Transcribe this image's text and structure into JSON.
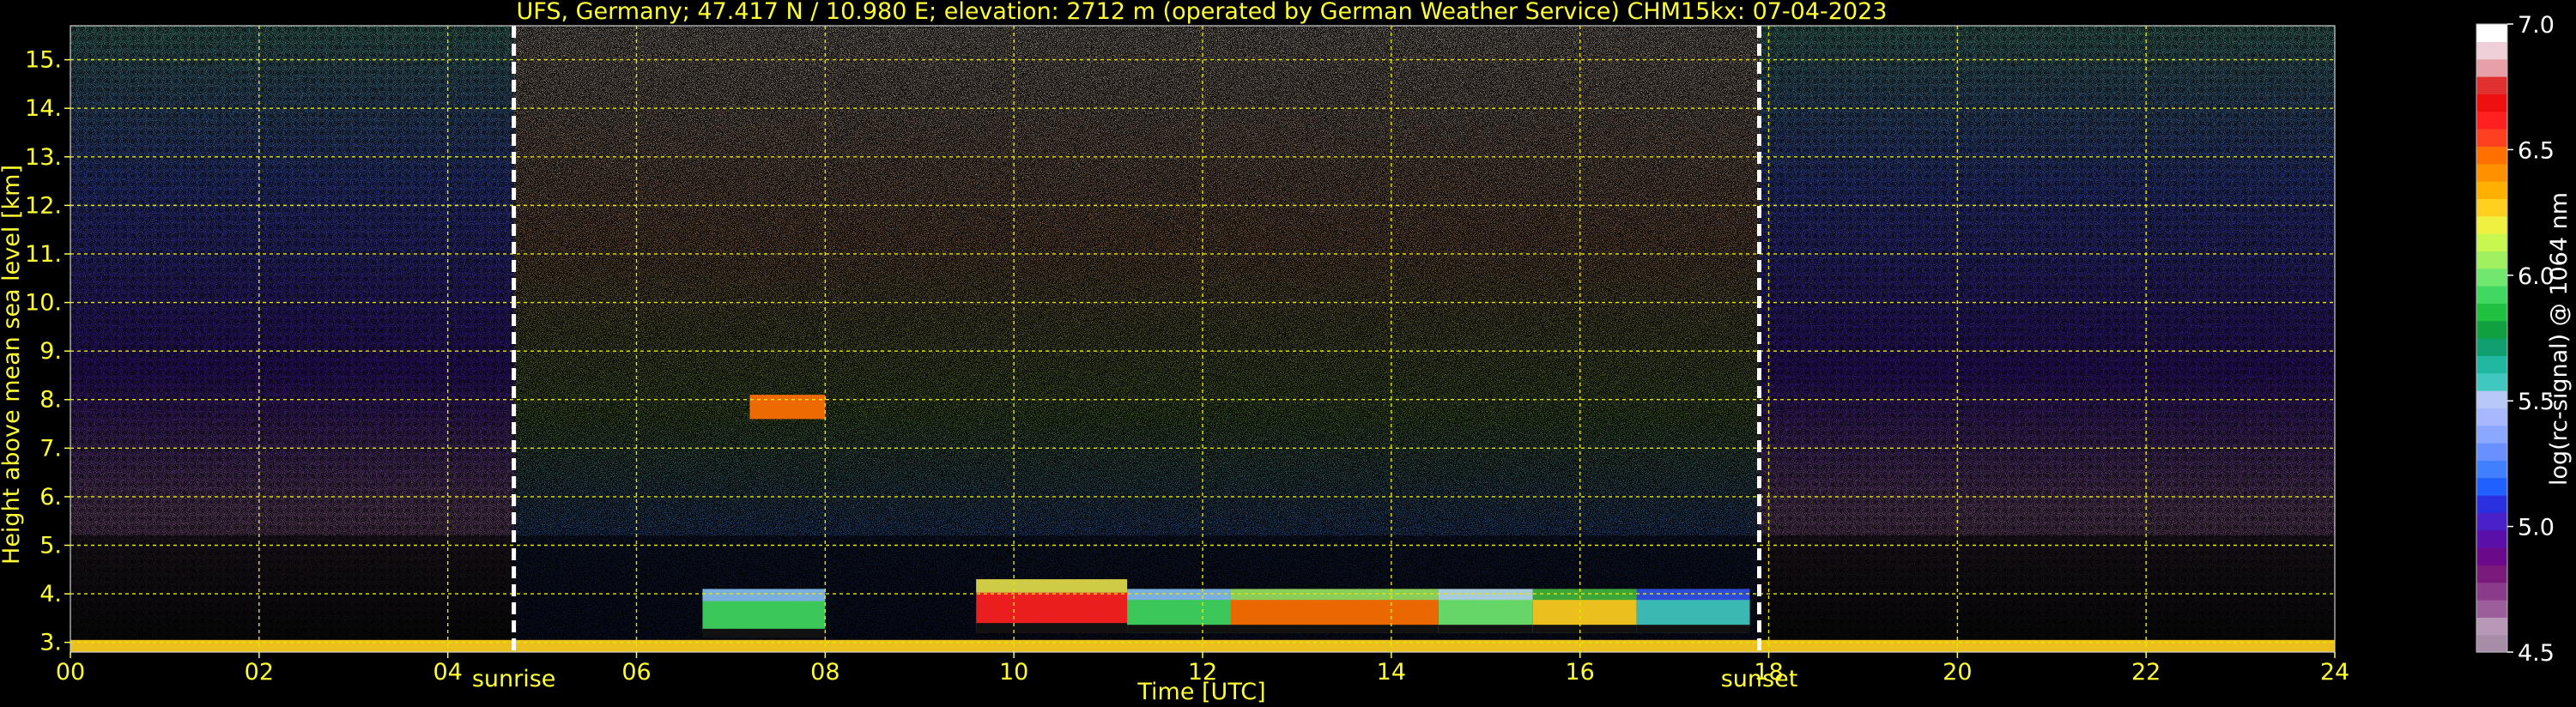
{
  "chart_data": {
    "type": "heatmap",
    "title": "UFS, Germany; 47.417 N / 10.980 E; elevation: 2712 m  (operated by German Weather Service)    CHM15kx: 07-04-2023",
    "xlabel": "Time [UTC]",
    "ylabel": "Height above mean sea level [km]",
    "colorbar_label": "log(rc-signal) @ 1064 nm",
    "xlim": [
      0,
      24
    ],
    "ylim": [
      2.8,
      15.7
    ],
    "grid": true,
    "x_ticks": [
      {
        "value": 0,
        "label": "00"
      },
      {
        "value": 2,
        "label": "02"
      },
      {
        "value": 4,
        "label": "04"
      },
      {
        "value": 6,
        "label": "06"
      },
      {
        "value": 8,
        "label": "08"
      },
      {
        "value": 10,
        "label": "10"
      },
      {
        "value": 12,
        "label": "12"
      },
      {
        "value": 14,
        "label": "14"
      },
      {
        "value": 16,
        "label": "16"
      },
      {
        "value": 18,
        "label": "18"
      },
      {
        "value": 20,
        "label": "20"
      },
      {
        "value": 22,
        "label": "22"
      },
      {
        "value": 24,
        "label": "24"
      }
    ],
    "y_ticks": [
      {
        "value": 3,
        "label": "3."
      },
      {
        "value": 4,
        "label": "4."
      },
      {
        "value": 5,
        "label": "5."
      },
      {
        "value": 6,
        "label": "6."
      },
      {
        "value": 7,
        "label": "7."
      },
      {
        "value": 8,
        "label": "8."
      },
      {
        "value": 9,
        "label": "9."
      },
      {
        "value": 10,
        "label": "10."
      },
      {
        "value": 11,
        "label": "11."
      },
      {
        "value": 12,
        "label": "12."
      },
      {
        "value": 13,
        "label": "13."
      },
      {
        "value": 14,
        "label": "14."
      },
      {
        "value": 15,
        "label": "15."
      }
    ],
    "markers": [
      {
        "label": "sunrise",
        "x": 4.7
      },
      {
        "label": "sunset",
        "x": 17.9
      }
    ],
    "colorbar": {
      "min": 4.5,
      "max": 7.0,
      "ticks": [
        {
          "value": 7.0,
          "label": "7.0"
        },
        {
          "value": 6.5,
          "label": "6.5"
        },
        {
          "value": 6.0,
          "label": "6.0"
        },
        {
          "value": 5.5,
          "label": "5.5"
        },
        {
          "value": 5.0,
          "label": "5.0"
        },
        {
          "value": 4.5,
          "label": "4.5"
        }
      ],
      "colors": [
        "#a78da8",
        "#b898b8",
        "#9c5f9c",
        "#8a3b8a",
        "#7a1a7a",
        "#6a0a8a",
        "#5a10a8",
        "#4a20c8",
        "#2a30e0",
        "#2060ff",
        "#4080ff",
        "#6a90ff",
        "#8aa8ff",
        "#a8b8ff",
        "#b8c8f8",
        "#40c8c0",
        "#20b8a0",
        "#10a070",
        "#10a040",
        "#20c040",
        "#40d860",
        "#70e870",
        "#a0f060",
        "#c8f850",
        "#f0f040",
        "#ffd020",
        "#ffb000",
        "#ff9000",
        "#ff7000",
        "#ff4020",
        "#ff2020",
        "#ee1010",
        "#e03030",
        "#e8a0a8",
        "#f0d0d8",
        "#ffffff"
      ]
    },
    "features": [
      {
        "kind": "cloud_layer",
        "x_range": [
          6.7,
          8.0
        ],
        "height_km": [
          3.1,
          4.1
        ],
        "level": 5.9
      },
      {
        "kind": "cloud_layer",
        "x_range": [
          9.6,
          11.2
        ],
        "height_km": [
          3.2,
          4.3
        ],
        "level": 6.6
      },
      {
        "kind": "cloud_layer",
        "x_range": [
          11.2,
          12.3
        ],
        "height_km": [
          3.2,
          4.1
        ],
        "level": 5.9
      },
      {
        "kind": "cloud_layer",
        "x_range": [
          12.3,
          14.5
        ],
        "height_km": [
          3.2,
          4.1
        ],
        "level": 6.5
      },
      {
        "kind": "cloud_layer",
        "x_range": [
          14.5,
          15.5
        ],
        "height_km": [
          3.2,
          4.1
        ],
        "level": 6.0
      },
      {
        "kind": "cloud_layer",
        "x_range": [
          15.5,
          16.6
        ],
        "height_km": [
          3.2,
          4.1
        ],
        "level": 6.3
      },
      {
        "kind": "cloud_layer",
        "x_range": [
          16.6,
          17.8
        ],
        "height_km": [
          3.2,
          4.1
        ],
        "level": 5.6
      },
      {
        "kind": "elevated_layer",
        "x_range": [
          7.2,
          8.0
        ],
        "height_km": [
          7.6,
          8.1
        ],
        "level": 6.5
      },
      {
        "kind": "boundary_layer",
        "x_range": [
          0.0,
          24.0
        ],
        "height_km": [
          2.8,
          3.05
        ],
        "level": 6.3
      }
    ]
  }
}
